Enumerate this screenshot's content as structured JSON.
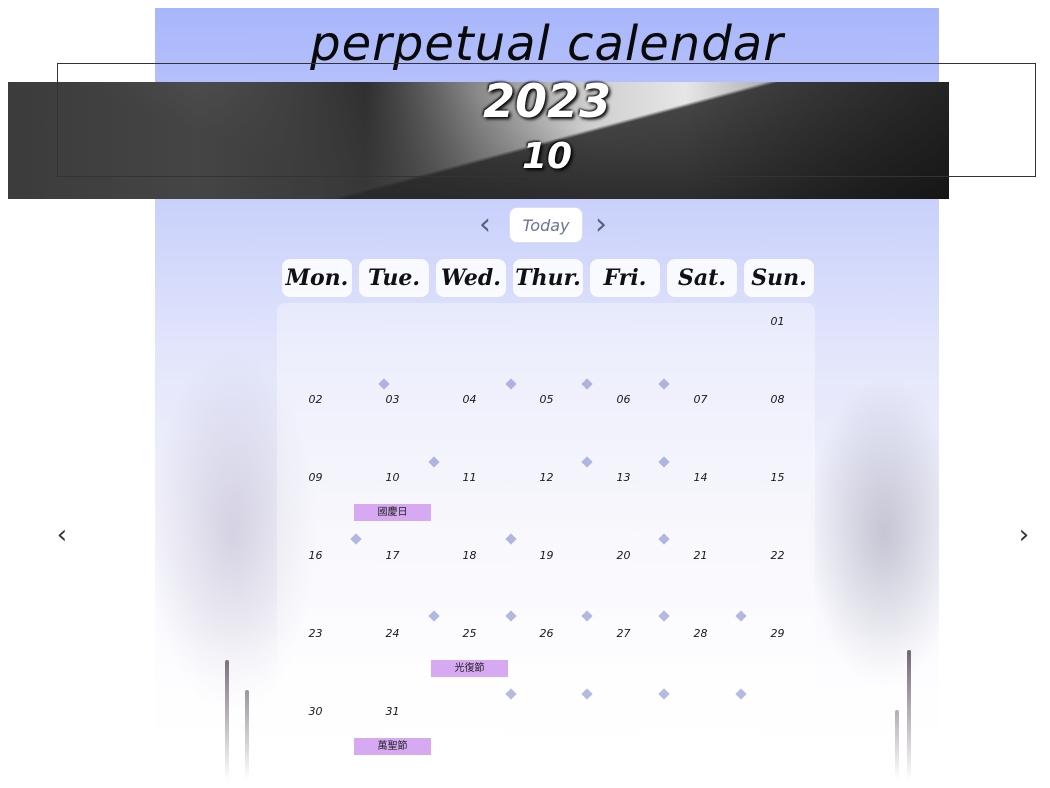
{
  "title": "perpetual calendar",
  "year": "2023",
  "month": "10",
  "nav": {
    "prev_icon": "‹",
    "today_label": "Today",
    "next_icon": "›"
  },
  "side": {
    "prev_icon": "‹",
    "next_icon": "›"
  },
  "weekdays": [
    "Mon.",
    "Tue.",
    "Wed.",
    "Thur.",
    "Fri.",
    "Sat.",
    "Sun."
  ],
  "days": [
    {
      "num": "01",
      "col": 6,
      "row": 0,
      "holiday": ""
    },
    {
      "num": "02",
      "col": 0,
      "row": 1,
      "holiday": ""
    },
    {
      "num": "03",
      "col": 1,
      "row": 1,
      "holiday": ""
    },
    {
      "num": "04",
      "col": 2,
      "row": 1,
      "holiday": ""
    },
    {
      "num": "05",
      "col": 3,
      "row": 1,
      "holiday": ""
    },
    {
      "num": "06",
      "col": 4,
      "row": 1,
      "holiday": ""
    },
    {
      "num": "07",
      "col": 5,
      "row": 1,
      "holiday": ""
    },
    {
      "num": "08",
      "col": 6,
      "row": 1,
      "holiday": ""
    },
    {
      "num": "09",
      "col": 0,
      "row": 2,
      "holiday": ""
    },
    {
      "num": "10",
      "col": 1,
      "row": 2,
      "holiday": "國慶日"
    },
    {
      "num": "11",
      "col": 2,
      "row": 2,
      "holiday": ""
    },
    {
      "num": "12",
      "col": 3,
      "row": 2,
      "holiday": ""
    },
    {
      "num": "13",
      "col": 4,
      "row": 2,
      "holiday": ""
    },
    {
      "num": "14",
      "col": 5,
      "row": 2,
      "holiday": ""
    },
    {
      "num": "15",
      "col": 6,
      "row": 2,
      "holiday": ""
    },
    {
      "num": "16",
      "col": 0,
      "row": 3,
      "holiday": ""
    },
    {
      "num": "17",
      "col": 1,
      "row": 3,
      "holiday": ""
    },
    {
      "num": "18",
      "col": 2,
      "row": 3,
      "holiday": ""
    },
    {
      "num": "19",
      "col": 3,
      "row": 3,
      "holiday": ""
    },
    {
      "num": "20",
      "col": 4,
      "row": 3,
      "holiday": ""
    },
    {
      "num": "21",
      "col": 5,
      "row": 3,
      "holiday": ""
    },
    {
      "num": "22",
      "col": 6,
      "row": 3,
      "holiday": ""
    },
    {
      "num": "23",
      "col": 0,
      "row": 4,
      "holiday": ""
    },
    {
      "num": "24",
      "col": 1,
      "row": 4,
      "holiday": ""
    },
    {
      "num": "25",
      "col": 2,
      "row": 4,
      "holiday": "光復節"
    },
    {
      "num": "26",
      "col": 3,
      "row": 4,
      "holiday": ""
    },
    {
      "num": "27",
      "col": 4,
      "row": 4,
      "holiday": ""
    },
    {
      "num": "28",
      "col": 5,
      "row": 4,
      "holiday": ""
    },
    {
      "num": "29",
      "col": 6,
      "row": 4,
      "holiday": ""
    },
    {
      "num": "30",
      "col": 0,
      "row": 5,
      "holiday": ""
    },
    {
      "num": "31",
      "col": 1,
      "row": 5,
      "holiday": "萬聖節"
    }
  ],
  "colors": {
    "holiday": "#d6a9f2",
    "header_sky": "#a8b6fb",
    "today_text": "#6b7399"
  }
}
